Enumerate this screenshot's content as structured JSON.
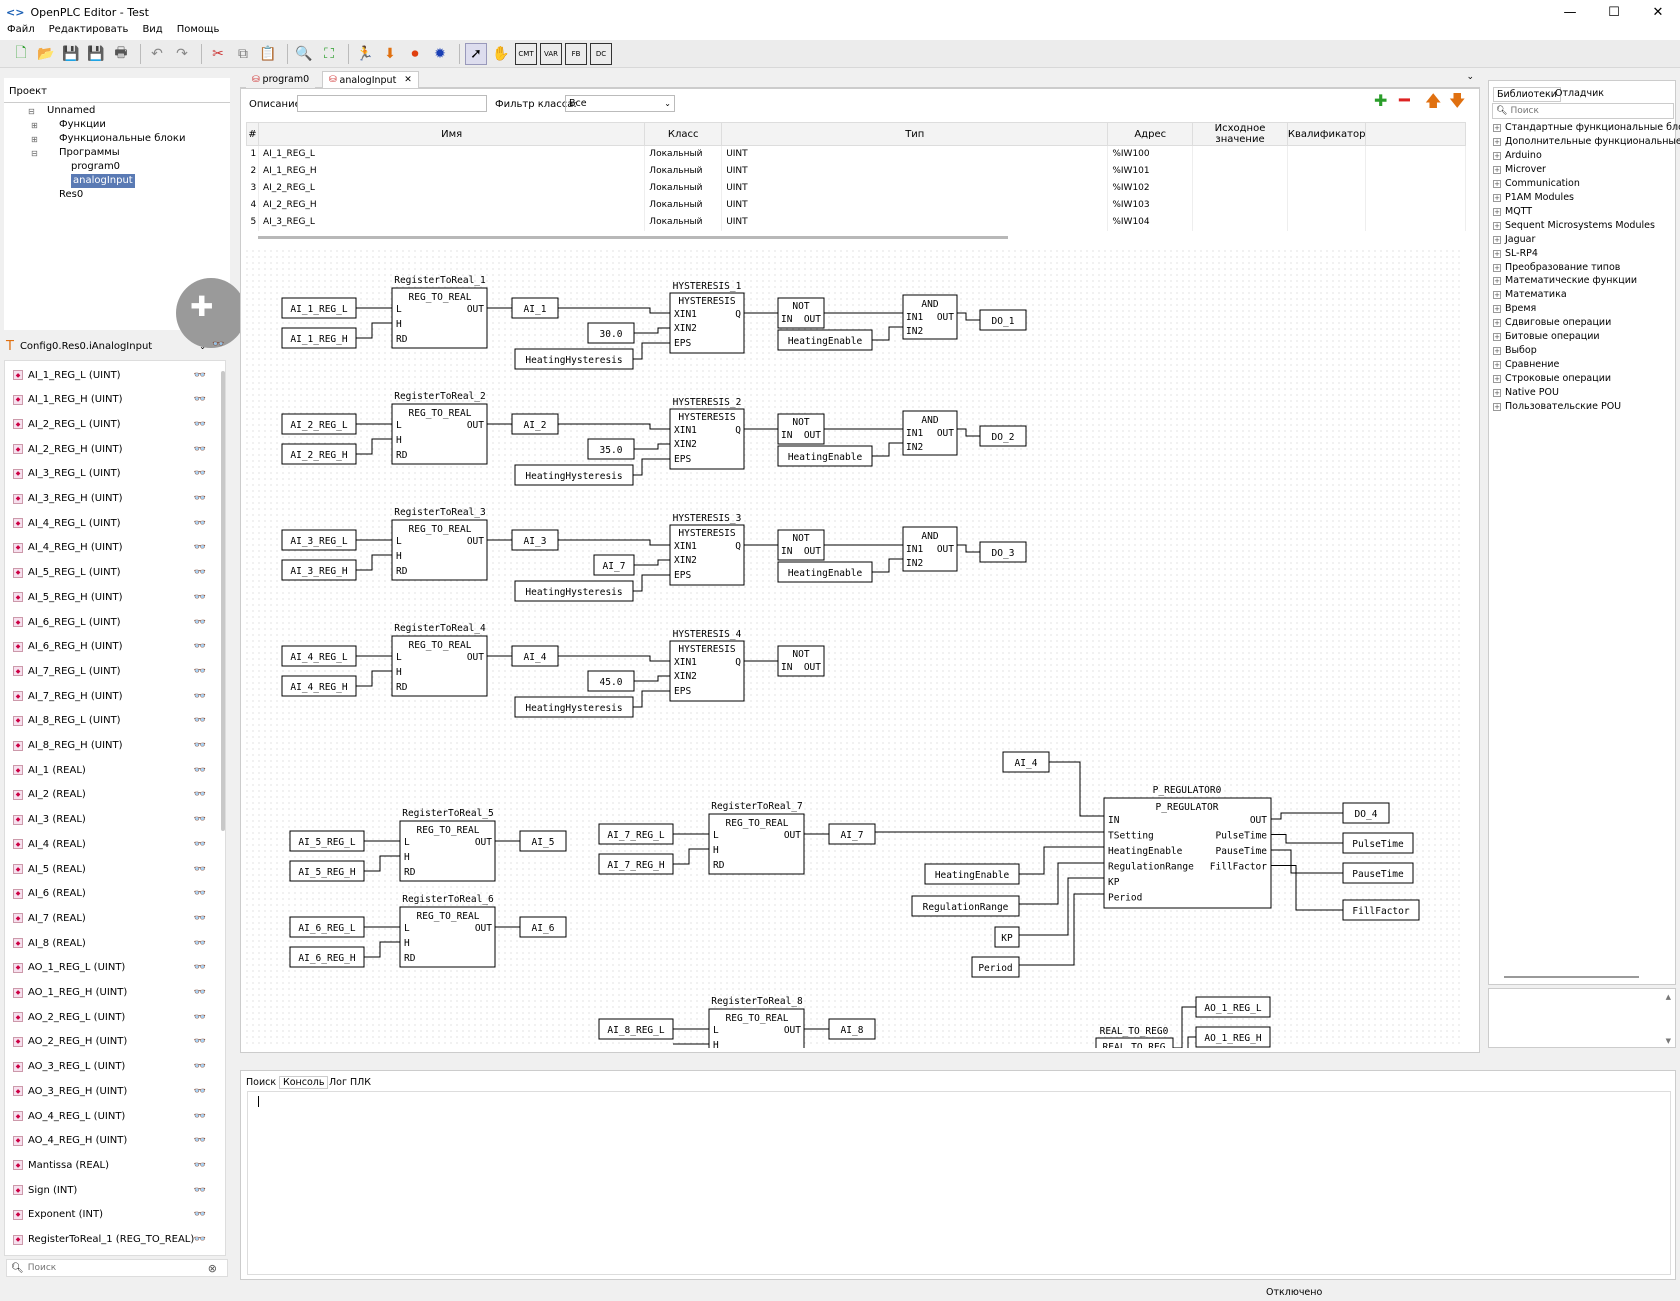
{
  "window": {
    "title": "OpenPLC Editor - Test",
    "min": "—",
    "max": "☐",
    "close": "✕"
  },
  "menu": [
    "Файл",
    "Редактировать",
    "Вид",
    "Помощь"
  ],
  "project_panel": {
    "tab": "Проект",
    "tree": [
      "Unnamed",
      "Функции",
      "Функциональные блоки",
      "Программы",
      "program0",
      "analogInput",
      "Res0"
    ]
  },
  "instance_selector": {
    "value": "Config0.Res0.iAnalogInput"
  },
  "variables": [
    "AI_1_REG_L (UINT)",
    "AI_1_REG_H (UINT)",
    "AI_2_REG_L (UINT)",
    "AI_2_REG_H (UINT)",
    "AI_3_REG_L (UINT)",
    "AI_3_REG_H (UINT)",
    "AI_4_REG_L (UINT)",
    "AI_4_REG_H (UINT)",
    "AI_5_REG_L (UINT)",
    "AI_5_REG_H (UINT)",
    "AI_6_REG_L (UINT)",
    "AI_6_REG_H (UINT)",
    "AI_7_REG_L (UINT)",
    "AI_7_REG_H (UINT)",
    "AI_8_REG_L (UINT)",
    "AI_8_REG_H (UINT)",
    "AI_1 (REAL)",
    "AI_2 (REAL)",
    "AI_3 (REAL)",
    "AI_4 (REAL)",
    "AI_5 (REAL)",
    "AI_6 (REAL)",
    "AI_7 (REAL)",
    "AI_8 (REAL)",
    "AO_1_REG_L (UINT)",
    "AO_1_REG_H (UINT)",
    "AO_2_REG_L (UINT)",
    "AO_2_REG_H (UINT)",
    "AO_3_REG_L (UINT)",
    "AO_3_REG_H (UINT)",
    "AO_4_REG_L (UINT)",
    "AO_4_REG_H (UINT)",
    "Mantissa (REAL)",
    "Sign (INT)",
    "Exponent (INT)",
    "RegisterToReal_1 (REG_TO_REAL)"
  ],
  "left_search": {
    "placeholder": "Поиск"
  },
  "editor_tabs": [
    "program0",
    "analogInput"
  ],
  "filter": {
    "desc_label": "Описание:",
    "desc_value": "",
    "class_label": "Фильтр класса:",
    "class_value": "Все"
  },
  "table": {
    "headers": [
      "#",
      "Имя",
      "Класс",
      "Тип",
      "Адрес",
      "Исходное значение",
      "Квалификатор"
    ],
    "rows": [
      [
        "1",
        "AI_1_REG_L",
        "Локальный",
        "UINT",
        "%IW100",
        "",
        ""
      ],
      [
        "2",
        "AI_1_REG_H",
        "Локальный",
        "UINT",
        "%IW101",
        "",
        ""
      ],
      [
        "3",
        "AI_2_REG_L",
        "Локальный",
        "UINT",
        "%IW102",
        "",
        ""
      ],
      [
        "4",
        "AI_2_REG_H",
        "Локальный",
        "UINT",
        "%IW103",
        "",
        ""
      ],
      [
        "5",
        "AI_3_REG_L",
        "Локальный",
        "UINT",
        "%IW104",
        "",
        ""
      ]
    ]
  },
  "library": {
    "tabs": [
      "Библиотеки",
      "Отладчик"
    ],
    "search_placeholder": "Поиск",
    "items": [
      "Стандартные функциональные блоки",
      "Дополнительные функциональные бл",
      "Arduino",
      "Microver",
      "Communication",
      "P1AM Modules",
      "MQTT",
      "Sequent Microsystems Modules",
      "Jaguar",
      "SL-RP4",
      "Преобразование типов",
      "Математические функции",
      "Математика",
      "Время",
      "Сдвиговые операции",
      "Битовые операции",
      "Выбор",
      "Сравнение",
      "Строковые операции",
      "Native POU",
      "Пользовательские POU"
    ]
  },
  "bottom_tabs": [
    "Поиск",
    "Консоль",
    "Лог ПЛК"
  ],
  "status": "Отключено",
  "diagram": {
    "rtr_type": "REG_TO_REAL",
    "hyst_type": "HYSTERESIS",
    "not_type": "NOT",
    "and_type": "AND",
    "rtr_names": [
      "RegisterToReal_1",
      "RegisterToReal_2",
      "RegisterToReal_3",
      "RegisterToReal_4",
      "RegisterToReal_5",
      "RegisterToReal_6",
      "RegisterToReal_7",
      "RegisterToReal_8"
    ],
    "hyst_names": [
      "HYSTERESIS_1",
      "HYSTERESIS_2",
      "HYSTERESIS_3",
      "HYSTERESIS_4"
    ],
    "rtr_inputs": [
      [
        "AI_1_REG_L",
        "AI_1_REG_H"
      ],
      [
        "AI_2_REG_L",
        "AI_2_REG_H"
      ],
      [
        "AI_3_REG_L",
        "AI_3_REG_H"
      ],
      [
        "AI_4_REG_L",
        "AI_4_REG_H"
      ],
      [
        "AI_5_REG_L",
        "AI_5_REG_H"
      ],
      [
        "AI_6_REG_L",
        "AI_6_REG_H"
      ],
      [
        "AI_7_REG_L",
        "AI_7_REG_H"
      ],
      [
        "AI_8_REG_L",
        ""
      ]
    ],
    "rtr_outputs": [
      "AI_1",
      "AI_2",
      "AI_3",
      "AI_4",
      "AI_5",
      "AI_6",
      "AI_7",
      "AI_8"
    ],
    "hyst_xin2": [
      "30.0",
      "35.0",
      "AI_7",
      "45.0"
    ],
    "hyst_eps": "HeatingHysteresis",
    "heating_enable": "HeatingEnable",
    "do_outputs": [
      "DO_1",
      "DO_2",
      "DO_3"
    ],
    "preg": {
      "name": "P_REGULATOR0",
      "type": "P_REGULATOR",
      "inputs": [
        "IN",
        "TSetting",
        "HeatingEnable",
        "RegulationRange",
        "KP",
        "Period"
      ],
      "outputs": [
        "OUT",
        "PulseTime",
        "PauseTime",
        "FillFactor"
      ],
      "in_vars": [
        "AI_4",
        "HeatingEnable",
        "RegulationRange",
        "KP",
        "Period"
      ],
      "out_vars": [
        "DO_4",
        "PulseTime",
        "PauseTime",
        "FillFactor"
      ]
    },
    "real_to_reg": {
      "name": "REAL_TO_REG0",
      "type": "REAL_TO_REG",
      "outs": [
        "AO_1_REG_L",
        "AO_1_REG_H"
      ]
    },
    "pins": {
      "L": "L",
      "H": "H",
      "RD": "RD",
      "OUT": "OUT",
      "Q": "Q",
      "XIN1": "XIN1",
      "XIN2": "XIN2",
      "EPS": "EPS",
      "IN": "IN",
      "IN1": "IN1",
      "IN2": "IN2"
    }
  }
}
